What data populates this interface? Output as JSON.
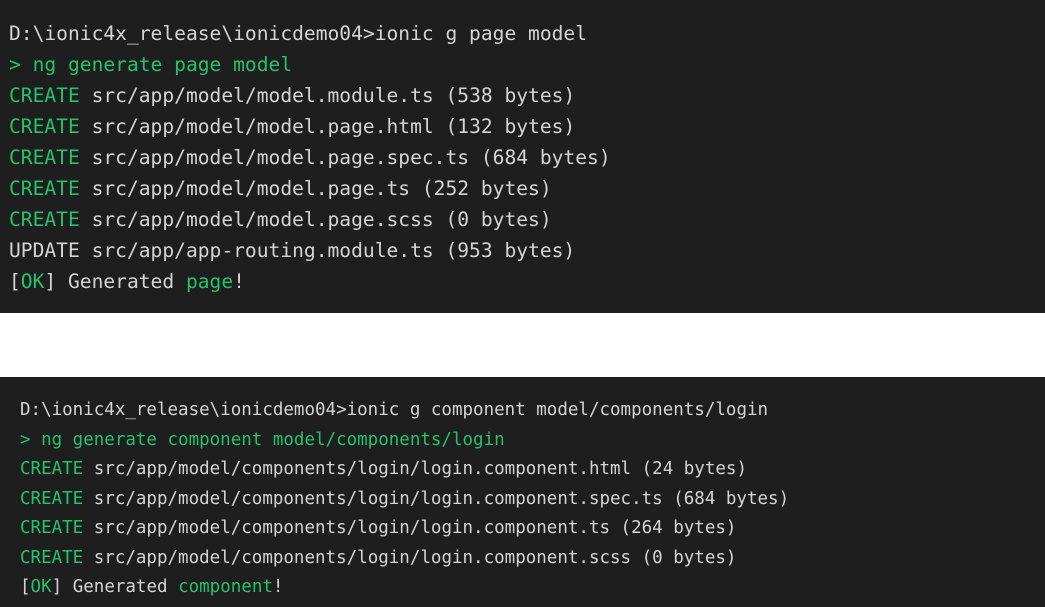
{
  "colors": {
    "terminal_bg": "#1e1e1e",
    "text": "#d4d4d4",
    "accent_green": "#23c26b"
  },
  "terminal1": {
    "prompt": "D:\\ionic4x_release\\ionicdemo04>ionic g page model",
    "ng_line": "> ng generate page model",
    "files": [
      {
        "action": "CREATE",
        "text": " src/app/model/model.module.ts (538 bytes)"
      },
      {
        "action": "CREATE",
        "text": " src/app/model/model.page.html (132 bytes)"
      },
      {
        "action": "CREATE",
        "text": " src/app/model/model.page.spec.ts (684 bytes)"
      },
      {
        "action": "CREATE",
        "text": " src/app/model/model.page.ts (252 bytes)"
      },
      {
        "action": "CREATE",
        "text": " src/app/model/model.page.scss (0 bytes)"
      }
    ],
    "update_line": "UPDATE src/app/app-routing.module.ts (953 bytes)",
    "ok": {
      "open": "[",
      "tag": "OK",
      "close": "]",
      "middle": " Generated ",
      "word": "page",
      "end": "!"
    }
  },
  "terminal2": {
    "prompt": "D:\\ionic4x_release\\ionicdemo04>ionic g component model/components/login",
    "ng_line": "> ng generate component model/components/login",
    "files": [
      {
        "action": "CREATE",
        "text": " src/app/model/components/login/login.component.html (24 bytes)"
      },
      {
        "action": "CREATE",
        "text": " src/app/model/components/login/login.component.spec.ts (684 bytes)"
      },
      {
        "action": "CREATE",
        "text": " src/app/model/components/login/login.component.ts (264 bytes)"
      },
      {
        "action": "CREATE",
        "text": " src/app/model/components/login/login.component.scss (0 bytes)"
      }
    ],
    "ok": {
      "open": "[",
      "tag": "OK",
      "close": "]",
      "middle": " Generated ",
      "word": "component",
      "end": "!"
    }
  }
}
